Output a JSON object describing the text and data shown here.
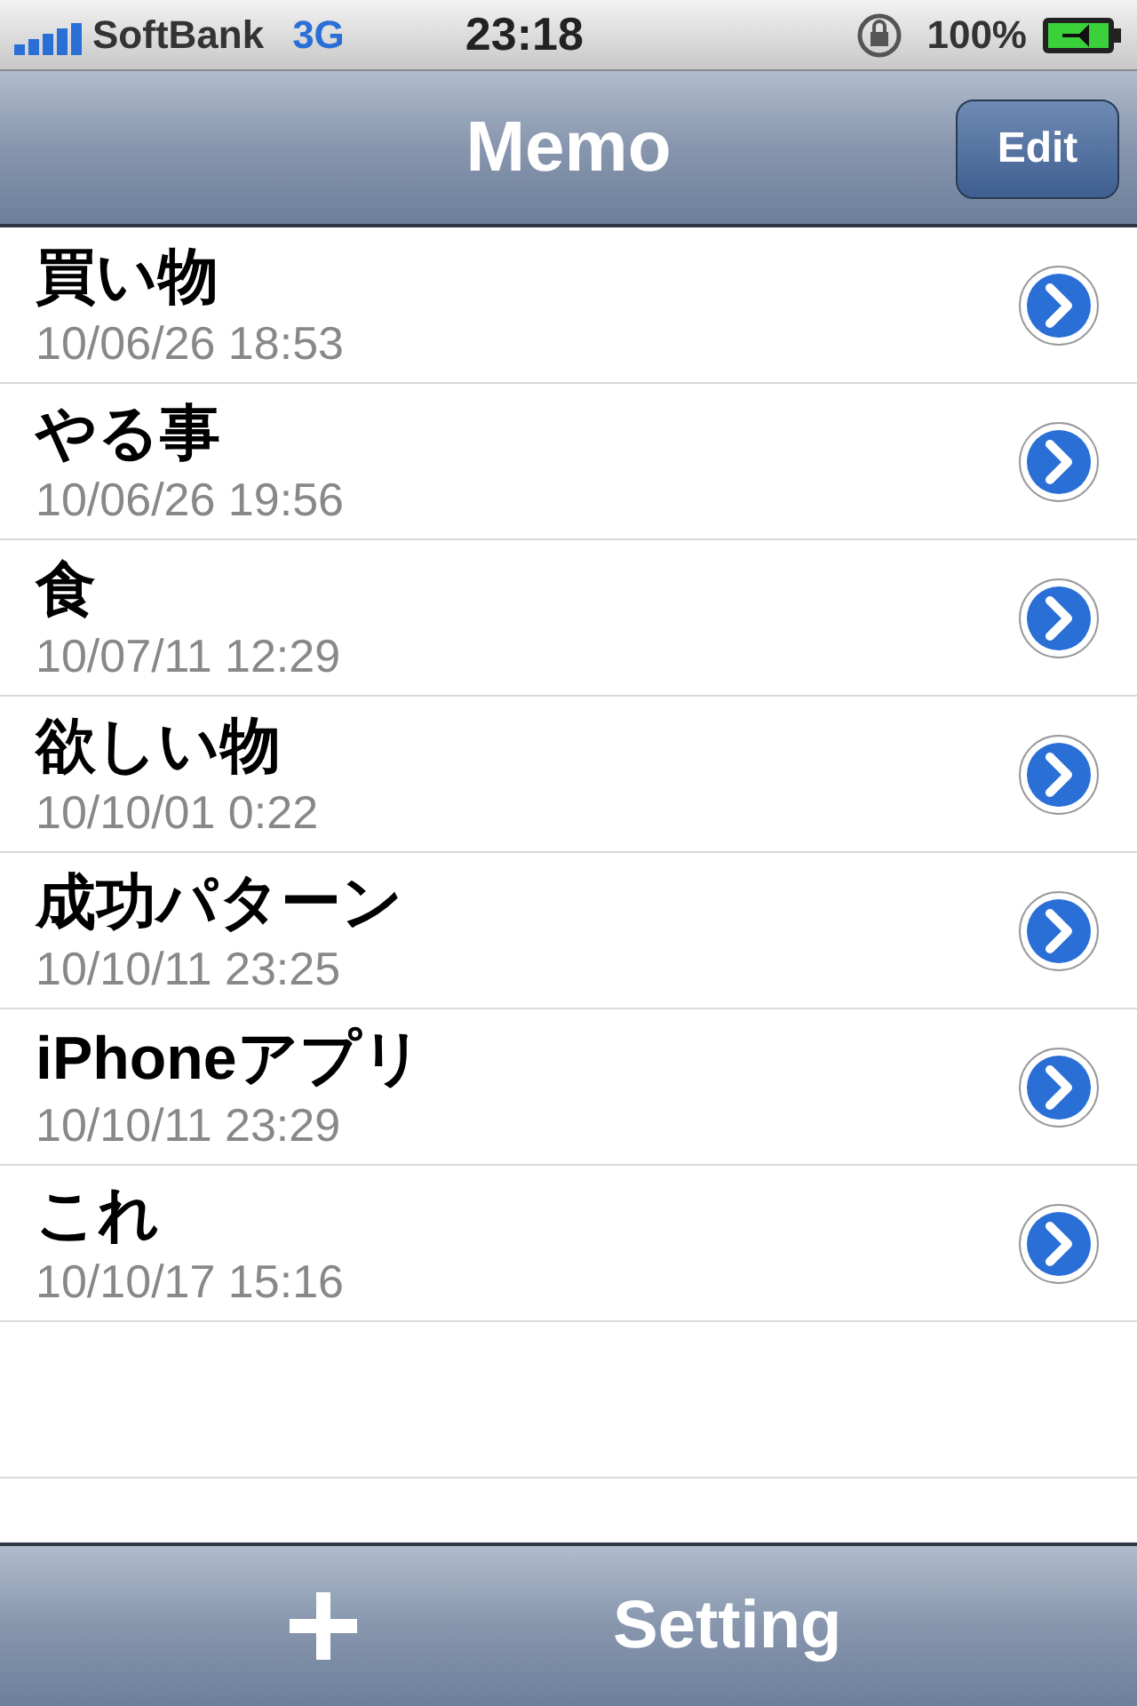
{
  "status_bar": {
    "carrier": "SoftBank",
    "network": "3G",
    "time": "23:18",
    "battery": "100%"
  },
  "nav_bar": {
    "title": "Memo",
    "edit_button": "Edit"
  },
  "memos": [
    {
      "title": "買い物",
      "date": "10/06/26 18:53"
    },
    {
      "title": "やる事",
      "date": "10/06/26 19:56"
    },
    {
      "title": "食",
      "date": "10/07/11 12:29"
    },
    {
      "title": "欲しい物",
      "date": "10/10/01 0:22"
    },
    {
      "title": "成功パターン",
      "date": "10/10/11 23:25"
    },
    {
      "title": "iPhoneアプリ",
      "date": "10/10/11 23:29"
    },
    {
      "title": "これ",
      "date": "10/10/17 15:16"
    }
  ],
  "toolbar": {
    "setting_button": "Setting"
  }
}
